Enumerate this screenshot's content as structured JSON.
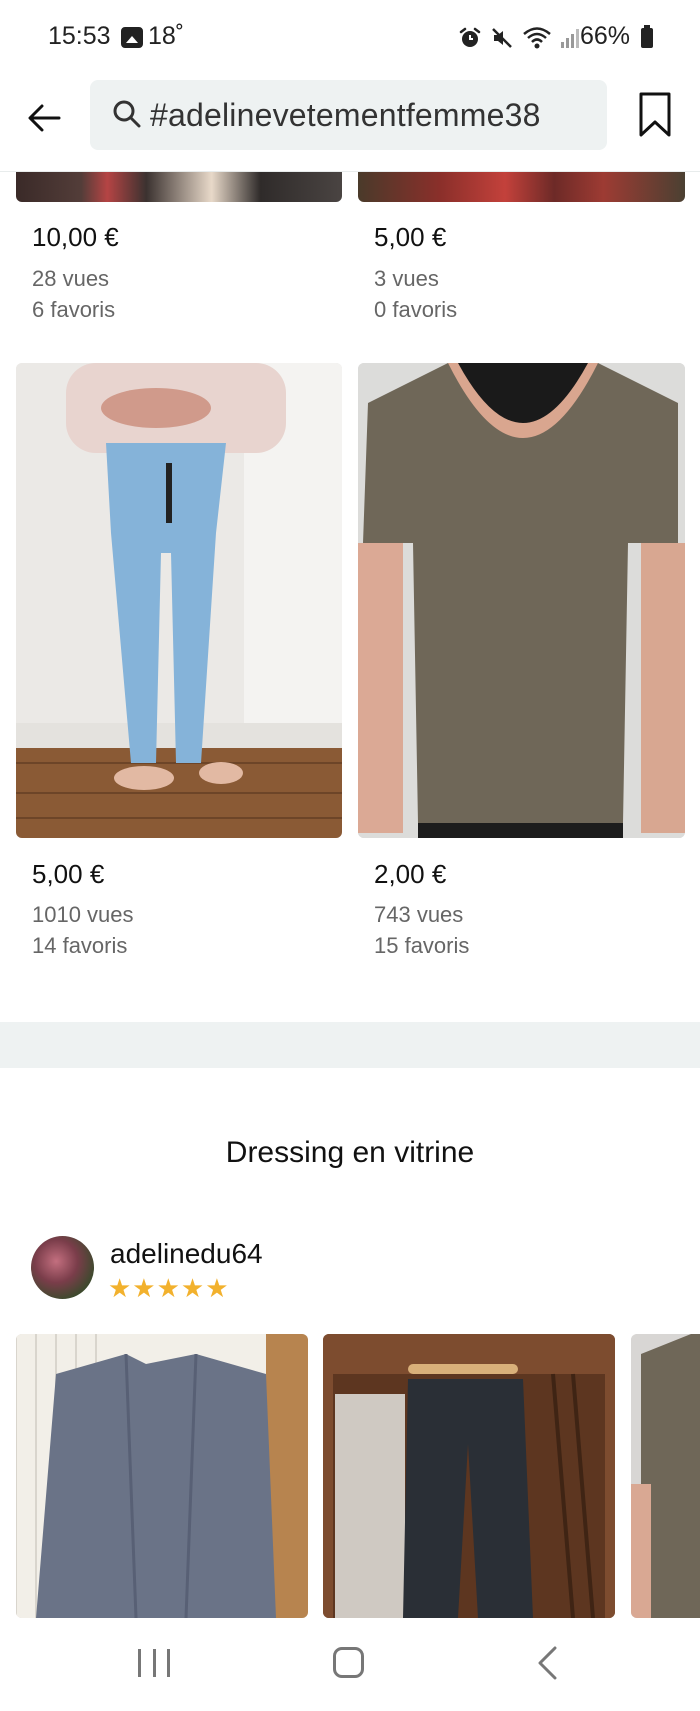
{
  "status_bar": {
    "time": "15:53",
    "temperature": "18˚",
    "battery": "66%"
  },
  "header": {
    "search_query": "#adelinevetementfemme38"
  },
  "products": [
    {
      "price": "10,00 €",
      "views": "28 vues",
      "favorites": "6 favoris"
    },
    {
      "price": "5,00 €",
      "views": "3 vues",
      "favorites": "0 favoris"
    },
    {
      "price": "5,00 €",
      "views": "1010 vues",
      "favorites": "14 favoris"
    },
    {
      "price": "2,00 €",
      "views": "743 vues",
      "favorites": "15 favoris"
    }
  ],
  "vitrine": {
    "title": "Dressing en vitrine",
    "username": "adelinedu64",
    "stars": "★★★★★",
    "rating": 5
  },
  "colors": {
    "accent_star": "#f2b12d",
    "search_bg": "#eef2f2",
    "secondary_text": "#666666"
  },
  "icons": [
    "back-arrow-icon",
    "search-icon",
    "bookmark-icon",
    "gallery-icon",
    "alarm-icon",
    "mute-icon",
    "wifi-icon",
    "signal-icon",
    "battery-icon"
  ]
}
